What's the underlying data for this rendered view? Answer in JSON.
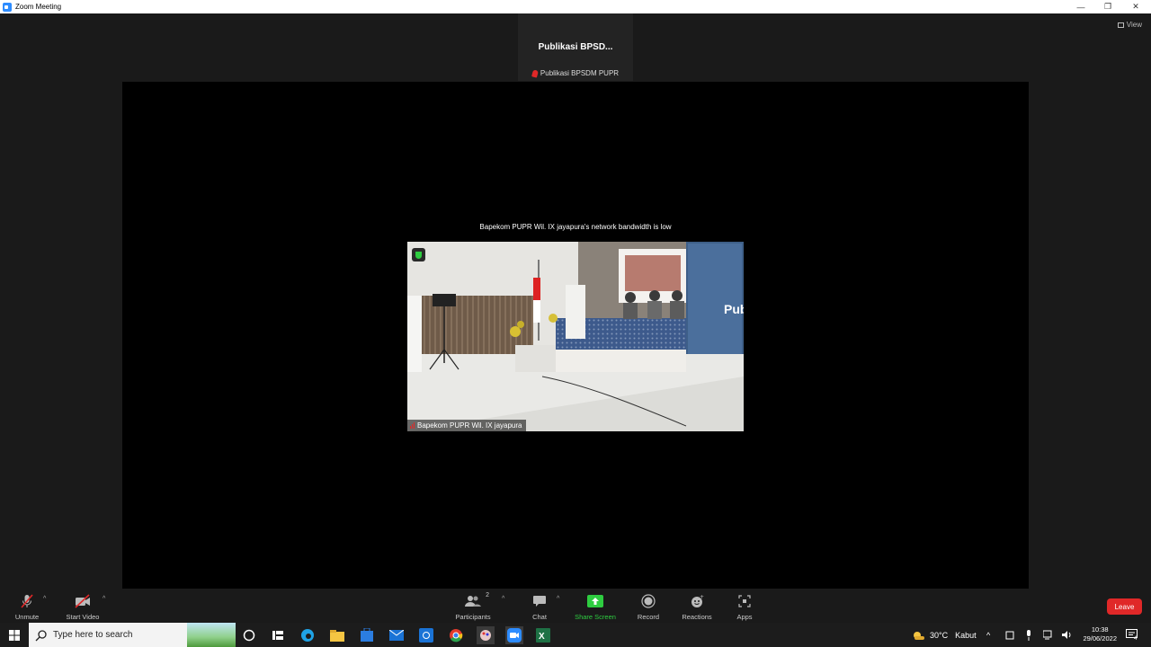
{
  "window": {
    "title": "Zoom Meeting"
  },
  "meeting": {
    "view_label": "View",
    "speaker_tile_name": "Publikasi  BPSD...",
    "speaker_tile_label": "Publikasi BPSDM PUPR",
    "bandwidth_message": "Bapekom PUPR Wil. IX jayapura's network bandwidth is low",
    "participant_label": "Bapekom PUPR Wil. IX jayapura"
  },
  "toolbar": {
    "unmute": "Unmute",
    "start_video": "Start Video",
    "participants": "Participants",
    "participants_count": "2",
    "chat": "Chat",
    "share_screen": "Share Screen",
    "record": "Record",
    "reactions": "Reactions",
    "apps": "Apps",
    "leave": "Leave"
  },
  "taskbar": {
    "search_placeholder": "Type here to search",
    "weather_temp": "30°C",
    "weather_desc": "Kabut",
    "time": "10:38",
    "date": "29/06/2022",
    "notification_count": "4"
  },
  "colors": {
    "accent_green": "#2ecc40",
    "leave_red": "#e02828",
    "zoom_blue": "#2d8cff"
  }
}
